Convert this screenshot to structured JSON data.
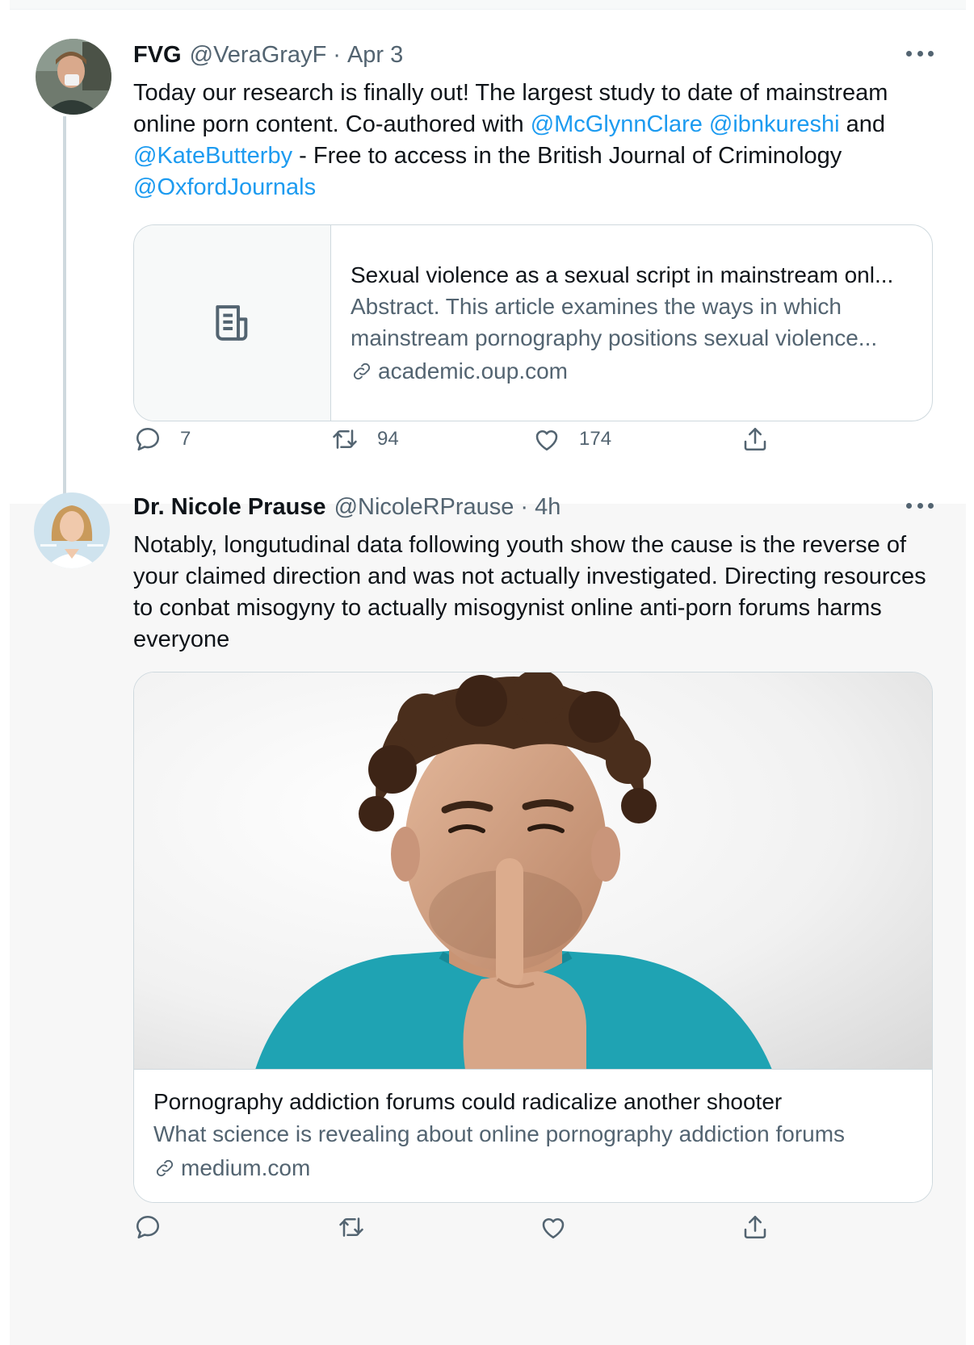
{
  "tweets": [
    {
      "name": "FVG",
      "handle": "@VeraGrayF",
      "dot": "·",
      "time": "Apr 3",
      "body": {
        "t1": "Today our research is finally out! The largest study to date of mainstream online porn content. Co-authored with ",
        "m1": "@McGlynnClare",
        "t2": " ",
        "m2": "@ibnkureshi",
        "t3": " and ",
        "m3": "@KateButterby",
        "t4": " - Free to access in the British Journal of Criminology ",
        "m4": "@OxfordJournals"
      },
      "card": {
        "title": "Sexual violence as a sexual script in mainstream onl...",
        "description": "Abstract. This article examines the ways in which mainstream pornography positions sexual violence...",
        "domain": "academic.oup.com",
        "thumb_icon": "article-icon"
      },
      "stats": {
        "replies": "7",
        "retweets": "94",
        "likes": "174"
      }
    },
    {
      "name": "Dr. Nicole Prause",
      "handle": "@NicoleRPrause",
      "dot": "·",
      "time": "4h",
      "body": "Notably, longutudinal data following youth show the cause is the reverse of your claimed direction and was not actually investigated. Directing resources to conbat misogyny to actually misogynist online anti-porn forums harms everyone",
      "card": {
        "title": "Pornography addiction forums could radicalize another shooter",
        "description": "What science is revealing about online pornography addiction forums",
        "domain": "medium.com",
        "image_subject": "man-shushing-photo"
      }
    }
  ],
  "colors": {
    "link": "#1d9bf0",
    "secondary_text": "#536471",
    "border": "#cfd9de",
    "shirt": "#1fa3b3"
  },
  "icons": [
    "reply-icon",
    "retweet-icon",
    "like-icon",
    "share-icon",
    "more-icon",
    "link-icon",
    "article-icon"
  ]
}
